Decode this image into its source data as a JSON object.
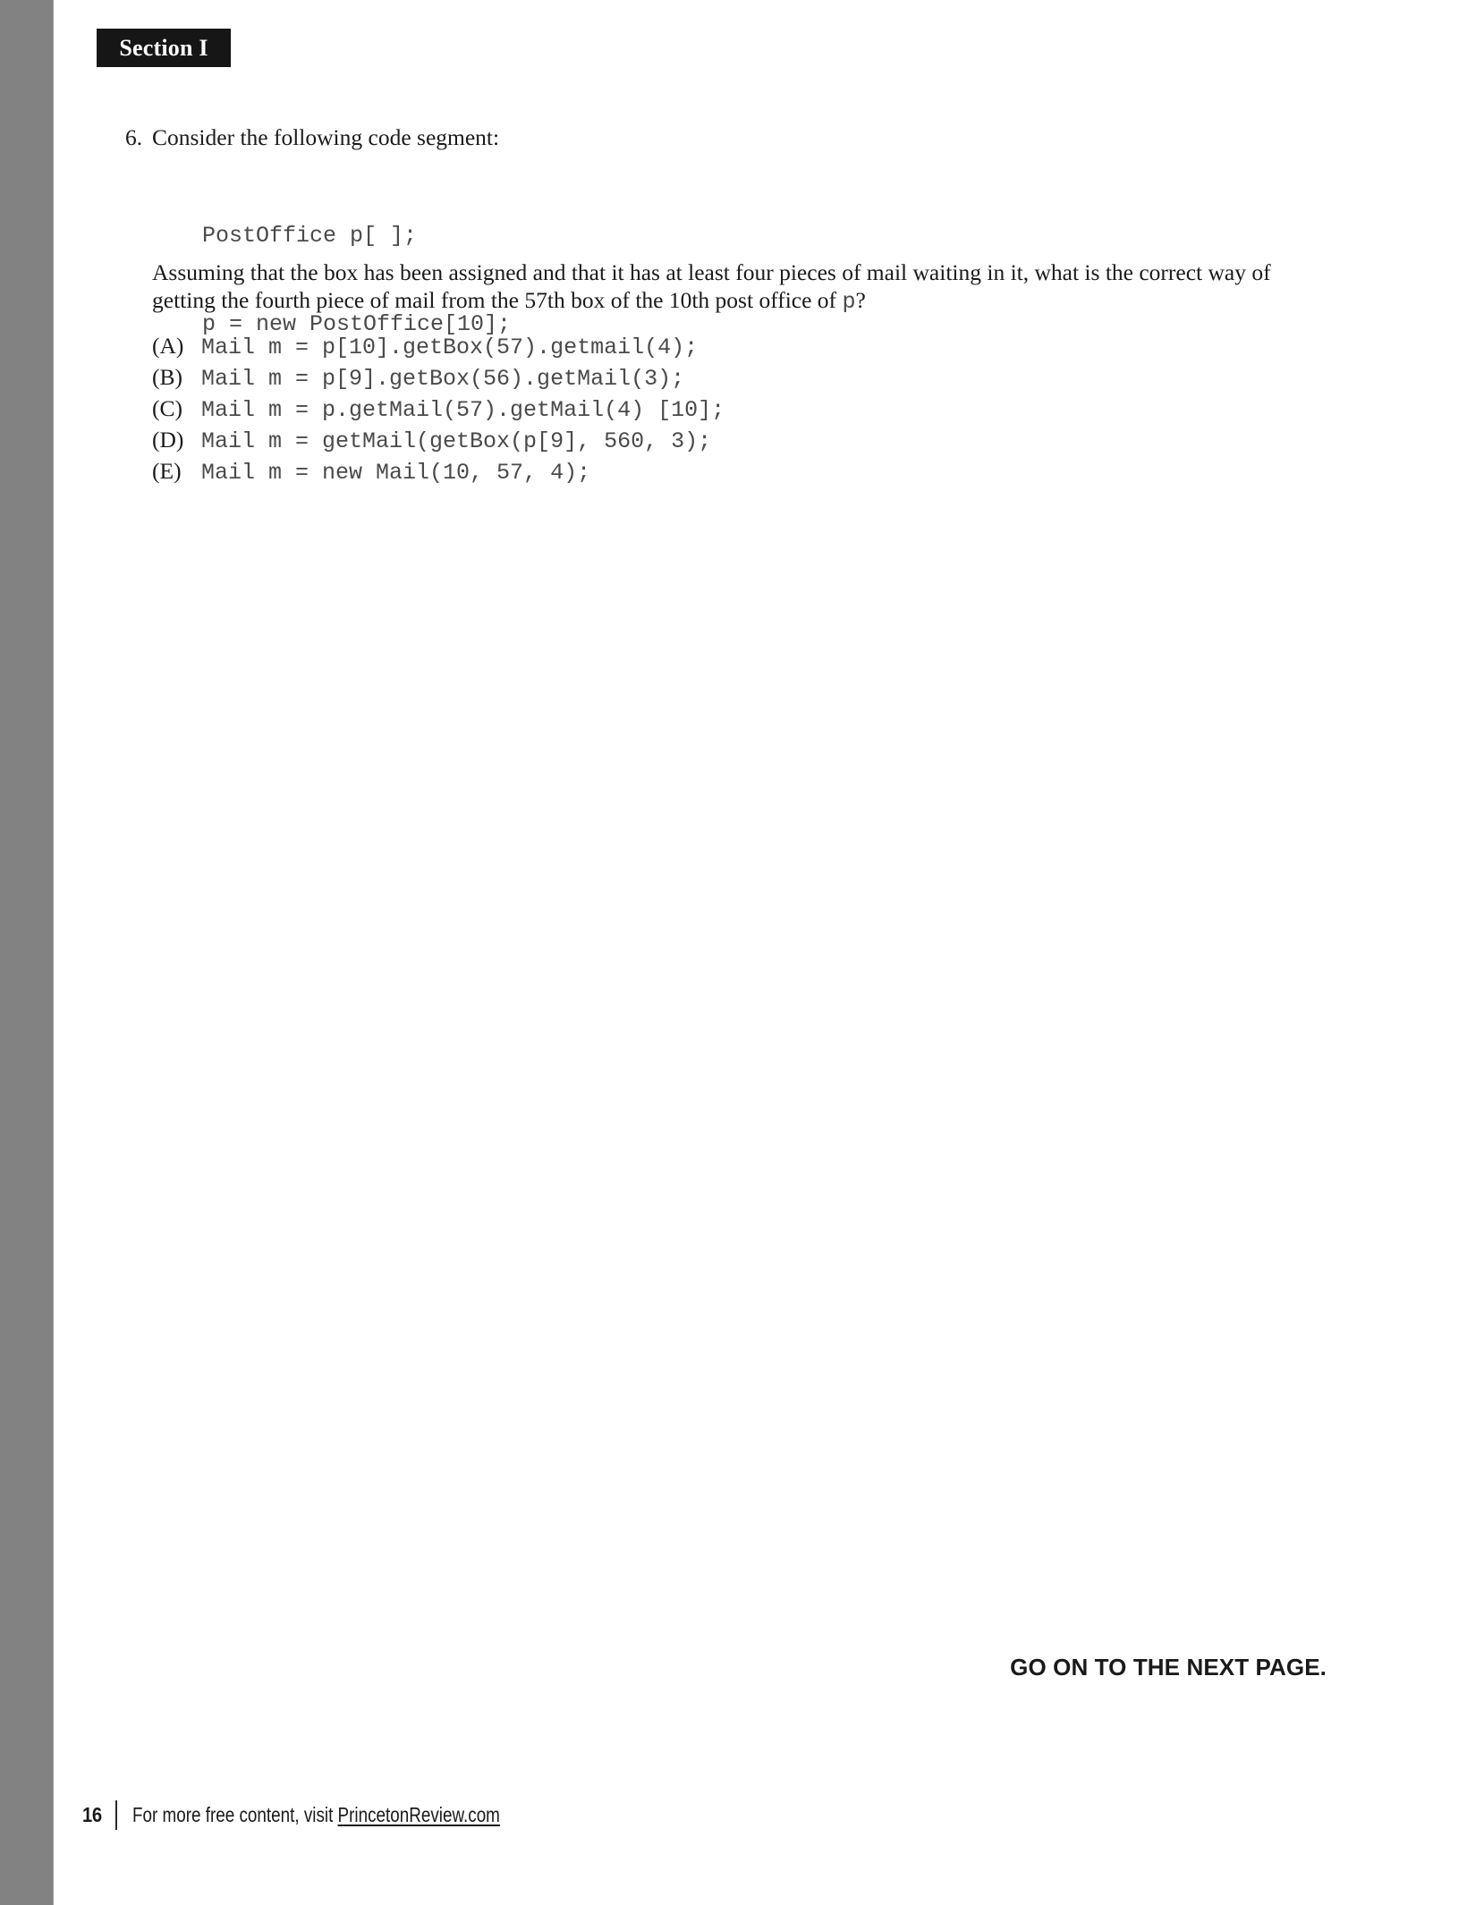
{
  "page": {
    "section_label": "Section I",
    "page_number": "16",
    "continue_notice": "GO ON TO THE NEXT PAGE.",
    "colors": {
      "side_bar": "#828282",
      "section_tag_bg": "#161616",
      "text": "#1a1a1a",
      "code_text": "#4a4a4a"
    }
  },
  "question": {
    "number": "6.",
    "prompt": "Consider the following code segment:",
    "code_lines": [
      "PostOffice p[ ];",
      "p = new PostOffice[10];"
    ],
    "body_text": "Assuming that the box has been assigned and that it has at least four pieces of mail waiting in it, what is the correct way of getting the fourth piece of mail from the 57th box of the 10th post office of ",
    "body_inline_code": "p",
    "body_end": "?",
    "options": [
      {
        "label": "(A)",
        "code": "Mail m = p[10].getBox(57).getmail(4);"
      },
      {
        "label": "(B)",
        "code": "Mail m = p[9].getBox(56).getMail(3);"
      },
      {
        "label": "(C)",
        "code": "Mail m = p.getMail(57).getMail(4) [10];"
      },
      {
        "label": "(D)",
        "code": "Mail m = getMail(getBox(p[9], 560, 3);"
      },
      {
        "label": "(E)",
        "code": "Mail m = new Mail(10, 57, 4);"
      }
    ]
  },
  "footer": {
    "text_prefix": "For more free content, visit ",
    "link_text": "PrincetonReview.com"
  }
}
